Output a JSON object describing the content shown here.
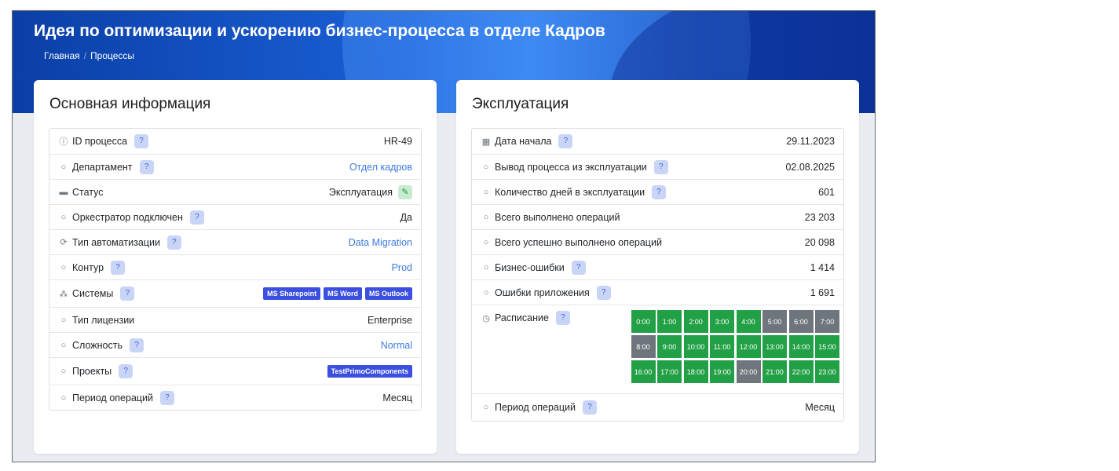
{
  "header": {
    "title": "Идея по оптимизации и ускорению бизнес-процесса в отделе Кадров",
    "breadcrumb": [
      "Главная",
      "Процессы"
    ]
  },
  "colors": {
    "hero": "#1a5fd6",
    "link": "#3d7be0",
    "tag": "#3b4fe0",
    "schedule_active": "#22a046",
    "schedule_inactive": "#6f757c"
  },
  "main_info": {
    "title": "Основная информация",
    "rows": [
      {
        "icon": "info-circle-icon",
        "glyph": "ⓘ",
        "label": "ID процесса",
        "help": true,
        "value": "HR-49"
      },
      {
        "icon": "circle-icon",
        "glyph": "○",
        "label": "Департамент",
        "help": true,
        "value": "Отдел кадров",
        "link": true
      },
      {
        "icon": "status-icon",
        "glyph": "▬",
        "label": "Статус",
        "help": false,
        "value": "Эксплуатация",
        "editable": true
      },
      {
        "icon": "circle-icon",
        "glyph": "○",
        "label": "Оркестратор подключен",
        "help": true,
        "value": "Да"
      },
      {
        "icon": "refresh-icon",
        "glyph": "⟳",
        "label": "Тип автоматизации",
        "help": true,
        "value": "Data Migration",
        "link": true
      },
      {
        "icon": "circle-icon",
        "glyph": "○",
        "label": "Контур",
        "help": true,
        "value": "Prod",
        "link": true
      },
      {
        "icon": "systems-icon",
        "glyph": "⁂",
        "label": "Системы",
        "help": true,
        "tags": [
          "MS Sharepoint",
          "MS Word",
          "MS Outlook"
        ]
      },
      {
        "icon": "circle-icon",
        "glyph": "○",
        "label": "Тип лицензии",
        "help": false,
        "value": "Enterprise"
      },
      {
        "icon": "circle-icon",
        "glyph": "○",
        "label": "Сложность",
        "help": true,
        "value": "Normal",
        "link": true
      },
      {
        "icon": "circle-icon",
        "glyph": "○",
        "label": "Проекты",
        "help": true,
        "tags": [
          "TestPrimoComponents"
        ]
      },
      {
        "icon": "circle-icon",
        "glyph": "○",
        "label": "Период операций",
        "help": true,
        "value": "Месяц"
      }
    ]
  },
  "exploitation": {
    "title": "Эксплуатация",
    "rows": [
      {
        "icon": "calendar-icon",
        "glyph": "▦",
        "label": "Дата начала",
        "help": true,
        "value": "29.11.2023"
      },
      {
        "icon": "circle-icon",
        "glyph": "○",
        "label": "Вывод процесса из эксплуатации",
        "help": true,
        "value": "02.08.2025"
      },
      {
        "icon": "circle-icon",
        "glyph": "○",
        "label": "Количество дней в эксплуатации",
        "help": true,
        "value": "601"
      },
      {
        "icon": "circle-icon",
        "glyph": "○",
        "label": "Всего выполнено операций",
        "help": false,
        "value": "23 203"
      },
      {
        "icon": "circle-icon",
        "glyph": "○",
        "label": "Всего успешно выполнено операций",
        "help": false,
        "value": "20 098"
      },
      {
        "icon": "circle-icon",
        "glyph": "○",
        "label": "Бизнес-ошибки",
        "help": true,
        "value": "1 414"
      },
      {
        "icon": "circle-icon",
        "glyph": "○",
        "label": "Ошибки приложения",
        "help": true,
        "value": "1 691"
      }
    ],
    "schedule": {
      "icon": "clock-icon",
      "glyph": "◷",
      "label": "Расписание",
      "hours": [
        {
          "label": "0:00",
          "active": true
        },
        {
          "label": "1:00",
          "active": true
        },
        {
          "label": "2:00",
          "active": true
        },
        {
          "label": "3:00",
          "active": true
        },
        {
          "label": "4:00",
          "active": true
        },
        {
          "label": "5:00",
          "active": false
        },
        {
          "label": "6:00",
          "active": false
        },
        {
          "label": "7:00",
          "active": false
        },
        {
          "label": "8:00",
          "active": false
        },
        {
          "label": "9:00",
          "active": true
        },
        {
          "label": "10:00",
          "active": true
        },
        {
          "label": "11:00",
          "active": true
        },
        {
          "label": "12:00",
          "active": true
        },
        {
          "label": "13:00",
          "active": true
        },
        {
          "label": "14:00",
          "active": true
        },
        {
          "label": "15:00",
          "active": true
        },
        {
          "label": "16:00",
          "active": true
        },
        {
          "label": "17:00",
          "active": true
        },
        {
          "label": "18:00",
          "active": true
        },
        {
          "label": "19:00",
          "active": true
        },
        {
          "label": "20:00",
          "active": false
        },
        {
          "label": "21:00",
          "active": true
        },
        {
          "label": "22:00",
          "active": true
        },
        {
          "label": "23:00",
          "active": true
        }
      ]
    },
    "period": {
      "icon": "circle-icon",
      "glyph": "○",
      "label": "Период операций",
      "help": true,
      "value": "Месяц"
    }
  }
}
